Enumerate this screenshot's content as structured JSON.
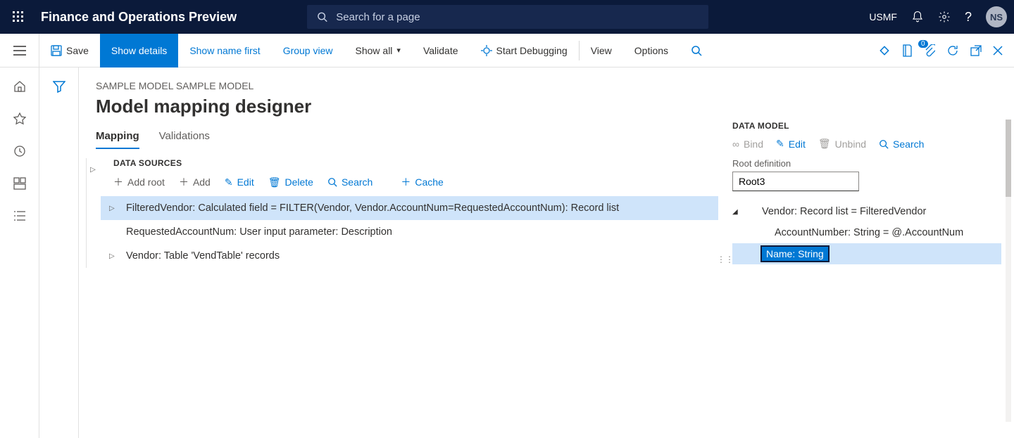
{
  "header": {
    "app_title": "Finance and Operations Preview",
    "search_placeholder": "Search for a page",
    "company": "USMF",
    "user_initials": "NS"
  },
  "actionbar": {
    "save": "Save",
    "show_details": "Show details",
    "show_name_first": "Show name first",
    "group_view": "Group view",
    "show_all": "Show all",
    "validate": "Validate",
    "start_debugging": "Start Debugging",
    "view": "View",
    "options": "Options",
    "attachment_count": "0"
  },
  "page": {
    "breadcrumb": "SAMPLE MODEL SAMPLE MODEL",
    "title": "Model mapping designer",
    "tabs": {
      "mapping": "Mapping",
      "validations": "Validations"
    }
  },
  "data_sources": {
    "heading": "DATA SOURCES",
    "tools": {
      "add_root": "Add root",
      "add": "Add",
      "edit": "Edit",
      "delete": "Delete",
      "search": "Search",
      "cache": "Cache"
    },
    "rows": [
      "FilteredVendor: Calculated field = FILTER(Vendor, Vendor.AccountNum=RequestedAccountNum): Record list",
      "RequestedAccountNum: User input parameter: Description",
      "Vendor: Table 'VendTable' records"
    ]
  },
  "data_model": {
    "heading": "DATA MODEL",
    "tools": {
      "bind": "Bind",
      "edit": "Edit",
      "unbind": "Unbind",
      "search": "Search"
    },
    "root_label": "Root definition",
    "root_value": "Root3",
    "rows": {
      "vendor": "Vendor: Record list = FilteredVendor",
      "account": "AccountNumber: String = @.AccountNum",
      "name": "Name: String"
    }
  }
}
